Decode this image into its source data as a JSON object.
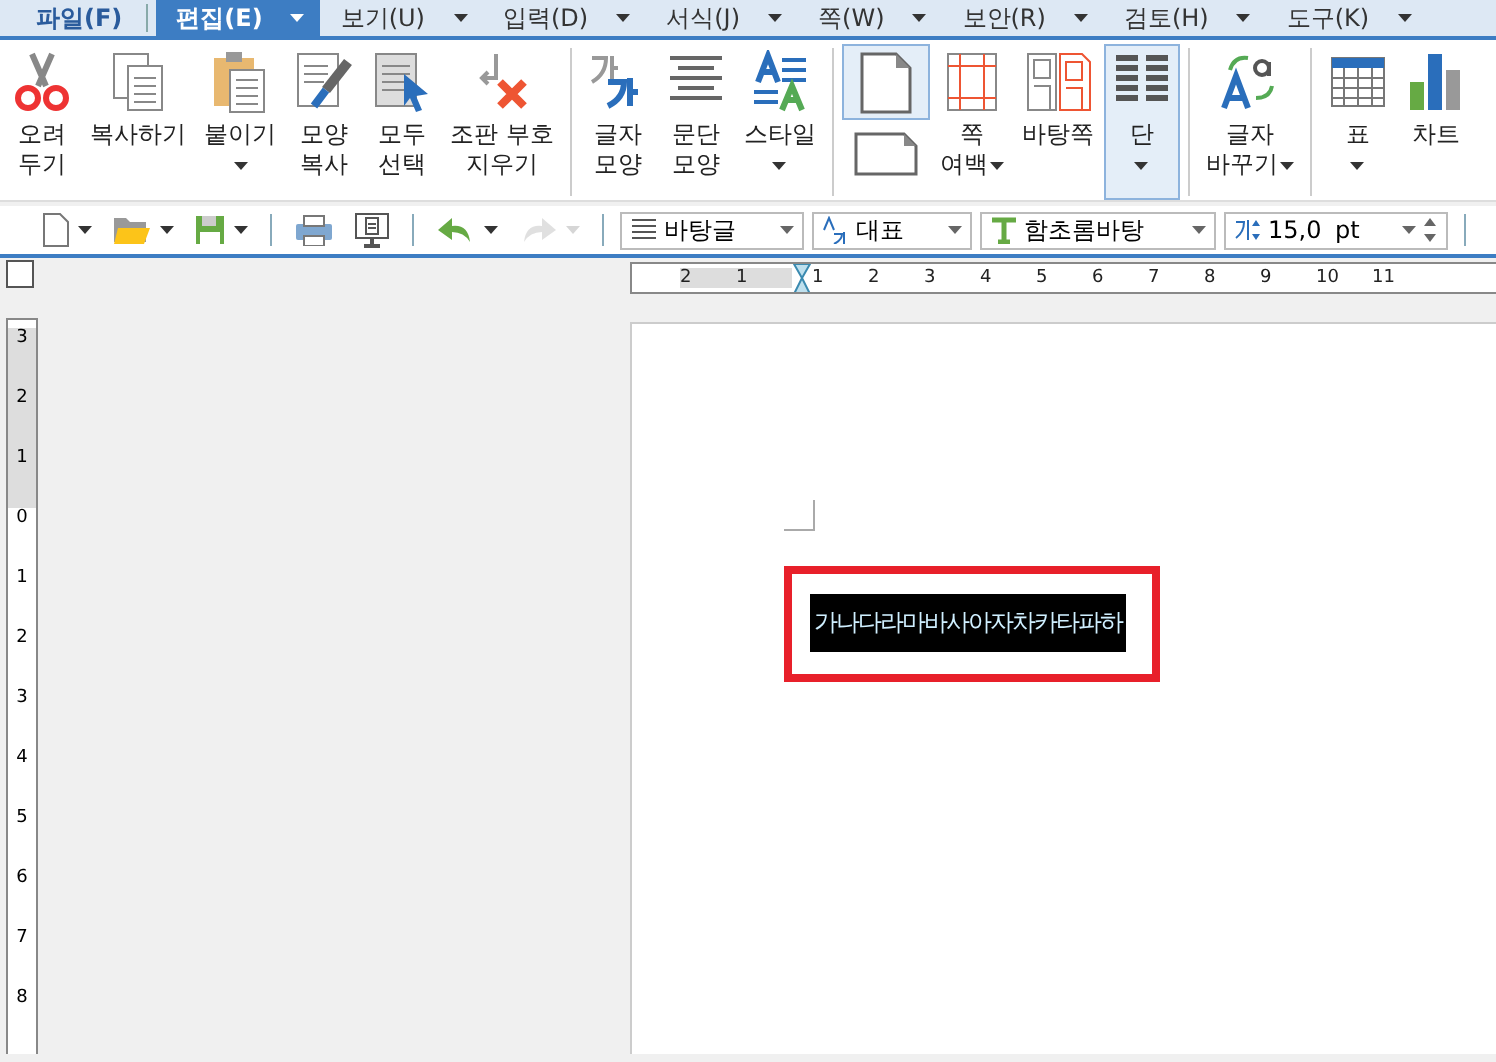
{
  "menu": [
    {
      "label": "파일(F)",
      "selected": false,
      "dropdown": false
    },
    {
      "label": "편집(E)",
      "selected": true,
      "dropdown": true
    },
    {
      "label": "보기(U)",
      "selected": false,
      "dropdown": true
    },
    {
      "label": "입력(D)",
      "selected": false,
      "dropdown": true
    },
    {
      "label": "서식(J)",
      "selected": false,
      "dropdown": true
    },
    {
      "label": "쪽(W)",
      "selected": false,
      "dropdown": true
    },
    {
      "label": "보안(R)",
      "selected": false,
      "dropdown": true
    },
    {
      "label": "검토(H)",
      "selected": false,
      "dropdown": true
    },
    {
      "label": "도구(K)",
      "selected": false,
      "dropdown": true
    }
  ],
  "ribbon": [
    {
      "items": [
        {
          "kind": "scissors",
          "lines": [
            "오려",
            "두기"
          ],
          "dropdown": false,
          "selected": false
        },
        {
          "kind": "copy",
          "lines": [
            "복사하기"
          ],
          "dropdown": false,
          "selected": false
        },
        {
          "kind": "paste",
          "lines": [
            "붙이기"
          ],
          "dropdown": true,
          "selected": false
        },
        {
          "kind": "format-copy",
          "lines": [
            "모양",
            "복사"
          ],
          "dropdown": false,
          "selected": false
        },
        {
          "kind": "select-all",
          "lines": [
            "모두",
            "선택"
          ],
          "dropdown": false,
          "selected": false
        },
        {
          "kind": "clear",
          "lines": [
            "조판 부호",
            "지우기"
          ],
          "dropdown": false,
          "selected": false
        }
      ]
    },
    {
      "items": [
        {
          "kind": "char-shape",
          "lines": [
            "글자",
            "모양"
          ],
          "dropdown": false,
          "selected": false
        },
        {
          "kind": "para-shape",
          "lines": [
            "문단",
            "모양"
          ],
          "dropdown": false,
          "selected": false
        },
        {
          "kind": "style",
          "lines": [
            "스타일"
          ],
          "dropdown": true,
          "selected": false
        }
      ]
    },
    {
      "items": [
        {
          "kind": "page",
          "dropdown": false,
          "selected": true
        },
        {
          "kind": "margin",
          "lines": [
            "쪽",
            "여백"
          ],
          "dropdown": true,
          "selected": false
        },
        {
          "kind": "master",
          "lines": [
            "바탕쪽"
          ],
          "dropdown": false,
          "selected": false
        },
        {
          "kind": "columns",
          "lines": [
            "단"
          ],
          "dropdown": true,
          "selected": true
        }
      ]
    },
    {
      "items": [
        {
          "kind": "replace",
          "lines": [
            "글자",
            "바꾸기"
          ],
          "dropdown": true,
          "selected": false
        }
      ]
    },
    {
      "items": [
        {
          "kind": "table",
          "lines": [
            "표"
          ],
          "dropdown": true,
          "selected": false
        },
        {
          "kind": "chart",
          "lines": [
            "차트"
          ],
          "dropdown": false,
          "selected": false
        }
      ]
    }
  ],
  "toolbar": [
    {
      "kind": "new",
      "dropdown": true,
      "disabled": false
    },
    {
      "kind": "open",
      "dropdown": true,
      "disabled": false
    },
    {
      "kind": "save",
      "dropdown": true,
      "disabled": false
    },
    {
      "kind": "sep"
    },
    {
      "kind": "print",
      "dropdown": false,
      "disabled": false
    },
    {
      "kind": "preview",
      "dropdown": false,
      "disabled": false
    },
    {
      "kind": "sep"
    },
    {
      "kind": "undo",
      "dropdown": true,
      "disabled": false
    },
    {
      "kind": "redo",
      "dropdown": true,
      "disabled": true
    },
    {
      "kind": "sep"
    }
  ],
  "format_bar": {
    "style": "바탕글",
    "language": "대표",
    "font": "함초롬바탕",
    "size": "15,0",
    "unit": "pt"
  },
  "ruler": {
    "horizontal": [
      "2",
      "1",
      "1",
      "2",
      "3",
      "4",
      "5",
      "6",
      "7",
      "8",
      "9",
      "10",
      "11"
    ],
    "vertical": [
      "3",
      "2",
      "1",
      "0",
      "1",
      "2",
      "3",
      "4",
      "5",
      "6",
      "7",
      "8"
    ]
  },
  "document": {
    "text": "가나다라마바사아자차카타파하",
    "highlighted": true
  }
}
